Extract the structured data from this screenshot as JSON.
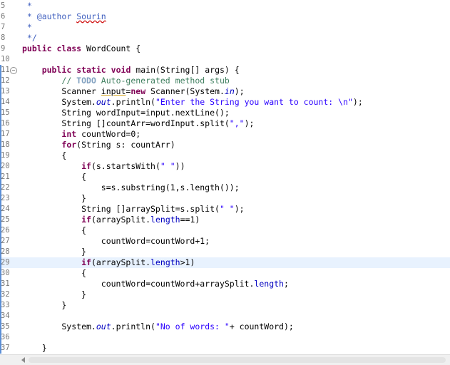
{
  "gutter": {
    "line_numbers": [
      "5",
      "6",
      "7",
      "8",
      "9",
      "10",
      "11",
      "12",
      "13",
      "14",
      "15",
      "16",
      "17",
      "18",
      "19",
      "20",
      "21",
      "22",
      "23",
      "24",
      "25",
      "26",
      "27",
      "28",
      "29",
      "30",
      "31",
      "32",
      "33",
      "34",
      "35",
      "36",
      "37"
    ]
  },
  "code_lines": [
    [
      {
        "t": " *",
        "c": "jd"
      }
    ],
    [
      {
        "t": " * ",
        "c": "jd"
      },
      {
        "t": "@author",
        "c": "jd"
      },
      {
        "t": " ",
        "c": "jd"
      },
      {
        "t": "Sourin",
        "c": "jd spell"
      }
    ],
    [
      {
        "t": " *",
        "c": "jd"
      }
    ],
    [
      {
        "t": " */",
        "c": "jd"
      }
    ],
    [
      {
        "t": "public",
        "c": "kw"
      },
      {
        "t": " "
      },
      {
        "t": "class",
        "c": "kw"
      },
      {
        "t": " WordCount {"
      }
    ],
    [],
    [
      {
        "t": "    "
      },
      {
        "t": "public",
        "c": "kw"
      },
      {
        "t": " "
      },
      {
        "t": "static",
        "c": "kw"
      },
      {
        "t": " "
      },
      {
        "t": "void",
        "c": "kw"
      },
      {
        "t": " main(String[] args) {"
      }
    ],
    [
      {
        "t": "        "
      },
      {
        "t": "// ",
        "c": "cm"
      },
      {
        "t": "TODO",
        "c": "todo"
      },
      {
        "t": " Auto-generated method stub",
        "c": "cm"
      }
    ],
    [
      {
        "t": "        Scanner "
      },
      {
        "t": "input",
        "c": "ul"
      },
      {
        "t": "="
      },
      {
        "t": "new",
        "c": "kw"
      },
      {
        "t": " Scanner(System."
      },
      {
        "t": "in",
        "c": "sfld"
      },
      {
        "t": ");"
      }
    ],
    [
      {
        "t": "        System."
      },
      {
        "t": "out",
        "c": "sfld"
      },
      {
        "t": ".println("
      },
      {
        "t": "\"Enter the String you want to count: \\n\"",
        "c": "str"
      },
      {
        "t": ");"
      }
    ],
    [
      {
        "t": "        String wordInput=input.nextLine();"
      }
    ],
    [
      {
        "t": "        String []countArr=wordInput.split("
      },
      {
        "t": "\",\"",
        "c": "str"
      },
      {
        "t": ");"
      }
    ],
    [
      {
        "t": "        "
      },
      {
        "t": "int",
        "c": "kw"
      },
      {
        "t": " countWord=0;"
      }
    ],
    [
      {
        "t": "        "
      },
      {
        "t": "for",
        "c": "kw"
      },
      {
        "t": "(String s: countArr)"
      }
    ],
    [
      {
        "t": "        {"
      }
    ],
    [
      {
        "t": "            "
      },
      {
        "t": "if",
        "c": "kw"
      },
      {
        "t": "(s.startsWith("
      },
      {
        "t": "\" \"",
        "c": "str"
      },
      {
        "t": "))"
      }
    ],
    [
      {
        "t": "            {"
      }
    ],
    [
      {
        "t": "                s=s.substring(1,s.length());"
      }
    ],
    [
      {
        "t": "            }"
      }
    ],
    [
      {
        "t": "            String []arraySplit=s.split("
      },
      {
        "t": "\" \"",
        "c": "str"
      },
      {
        "t": ");"
      }
    ],
    [
      {
        "t": "            "
      },
      {
        "t": "if",
        "c": "kw"
      },
      {
        "t": "(arraySplit."
      },
      {
        "t": "length",
        "c": "fld"
      },
      {
        "t": "==1)"
      }
    ],
    [
      {
        "t": "            {"
      }
    ],
    [
      {
        "t": "                countWord=countWord+1;"
      }
    ],
    [
      {
        "t": "            }"
      }
    ],
    [
      {
        "t": "            "
      },
      {
        "t": "if",
        "c": "kw"
      },
      {
        "t": "(arraySplit."
      },
      {
        "t": "length",
        "c": "fld"
      },
      {
        "t": ">1)"
      }
    ],
    [
      {
        "t": "            {"
      }
    ],
    [
      {
        "t": "                countWord=countWord+arraySplit."
      },
      {
        "t": "length",
        "c": "fld"
      },
      {
        "t": ";"
      }
    ],
    [
      {
        "t": "            }"
      }
    ],
    [
      {
        "t": "        }"
      }
    ],
    [],
    [
      {
        "t": "        System."
      },
      {
        "t": "out",
        "c": "sfld"
      },
      {
        "t": ".println("
      },
      {
        "t": "\"No of words: \"",
        "c": "str"
      },
      {
        "t": "+ countWord);"
      }
    ],
    [],
    [
      {
        "t": "    }"
      }
    ]
  ],
  "current_line_index": 24,
  "fold_marker_line_index": 6,
  "fold_icon": "minus-icon",
  "change_marker_line_indices": [
    6,
    7,
    8,
    9,
    10,
    11,
    12,
    13,
    14,
    15,
    16,
    17,
    18,
    19,
    20,
    21,
    22,
    23,
    24,
    25,
    26,
    27,
    28,
    29,
    30,
    31,
    32
  ],
  "colors": {
    "keyword": "#7f0055",
    "comment": "#3f7f5f",
    "javadoc": "#3f5fbf",
    "string": "#2a00ff",
    "field": "#0000c0",
    "current_line": "#e8f2fe",
    "change_marker": "#5b8fd6"
  },
  "scrollbar": {
    "left_arrow_icon": "arrow-left-icon"
  }
}
